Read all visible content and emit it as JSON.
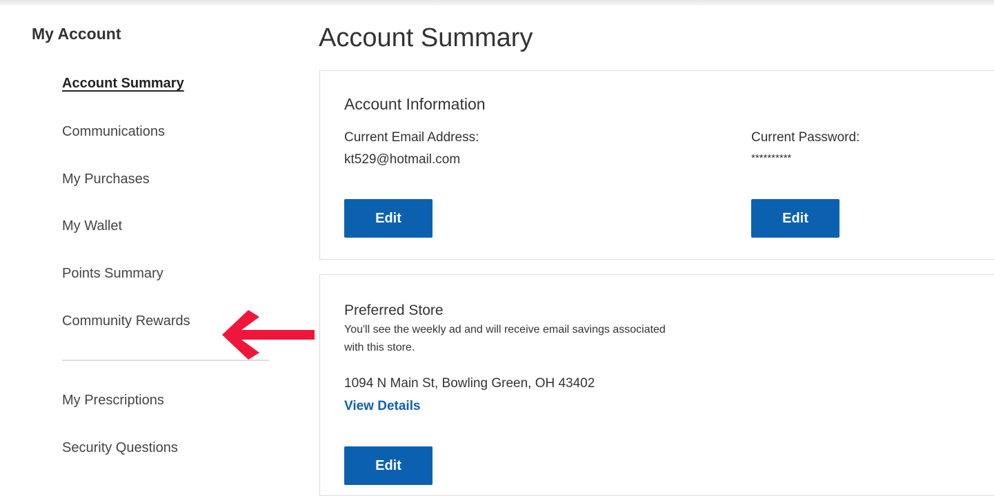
{
  "sidebar": {
    "title": "My Account",
    "items": [
      {
        "label": "Account Summary",
        "active": true
      },
      {
        "label": "Communications"
      },
      {
        "label": "My Purchases"
      },
      {
        "label": "My Wallet"
      },
      {
        "label": "Points Summary"
      },
      {
        "label": "Community Rewards"
      },
      {
        "label": "My Prescriptions"
      },
      {
        "label": "Security Questions"
      }
    ]
  },
  "main": {
    "title": "Account Summary",
    "account_info": {
      "heading": "Account Information",
      "email_label": "Current Email Address:",
      "email_value": "kt529@hotmail.com",
      "password_label": "Current Password:",
      "password_value": "**********",
      "email_edit_label": "Edit",
      "password_edit_label": "Edit"
    },
    "preferred_store": {
      "heading": "Preferred Store",
      "description": "You'll see the weekly ad and will receive email savings associated with this store.",
      "address": "1094 N Main St, Bowling Green, OH 43402",
      "details_link": "View Details",
      "edit_label": "Edit"
    }
  },
  "annotation": {
    "arrow_color": "#f0163a",
    "arrow_icon": "left-arrow-icon"
  },
  "colors": {
    "primary_button": "#0b61b0",
    "link": "#0b61b0"
  }
}
